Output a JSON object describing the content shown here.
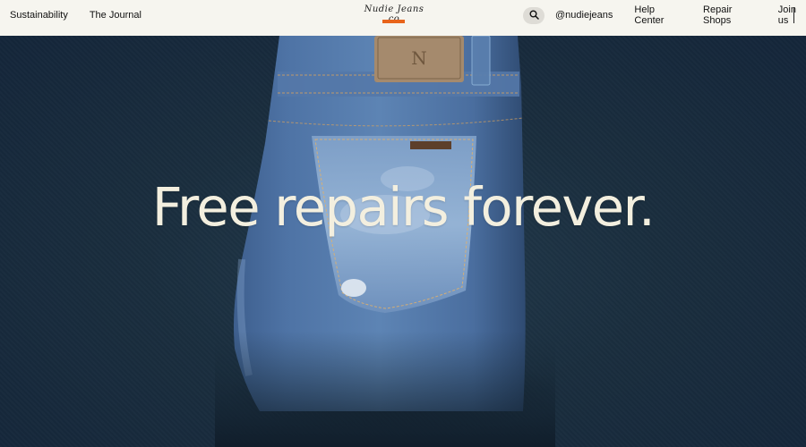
{
  "header": {
    "nav_left": [
      "Sustainability",
      "The Journal"
    ],
    "logo": "Nudie Jeans co",
    "nav_right": [
      "@nudiejeans",
      "Help Center",
      "Repair Shops",
      "Join us"
    ],
    "search_icon": "search-icon",
    "accent_color": "#e8641b"
  },
  "hero": {
    "headline": "Free repairs forever.",
    "image": "folded-jeans-back-pocket",
    "background_color": "#1a2e3d",
    "text_color": "#f3efdf"
  }
}
